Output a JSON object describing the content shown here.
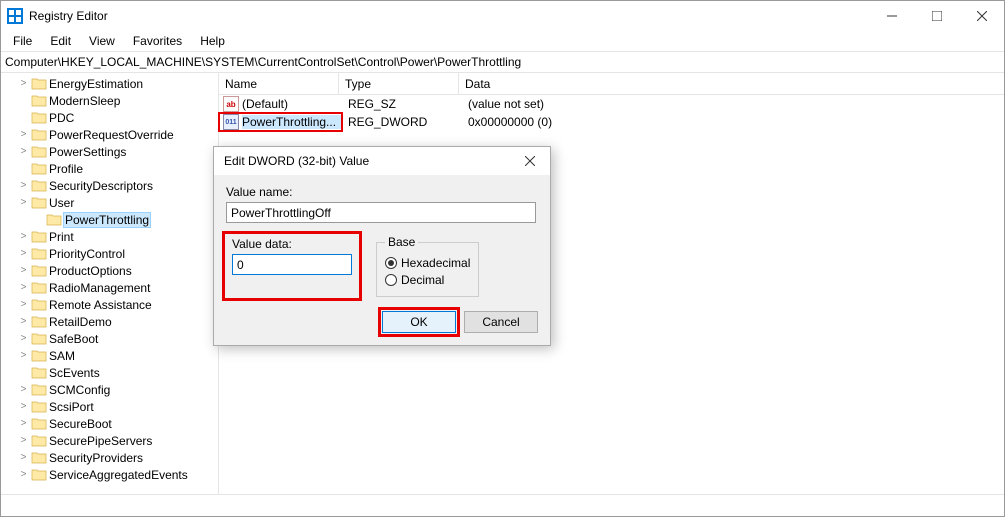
{
  "window": {
    "title": "Registry Editor"
  },
  "menu": {
    "file": "File",
    "edit": "Edit",
    "view": "View",
    "favorites": "Favorites",
    "help": "Help"
  },
  "address": "Computer\\HKEY_LOCAL_MACHINE\\SYSTEM\\CurrentControlSet\\Control\\Power\\PowerThrottling",
  "tree": {
    "items": [
      "EnergyEstimation",
      "ModernSleep",
      "PDC",
      "PowerRequestOverride",
      "PowerSettings",
      "Profile",
      "SecurityDescriptors",
      "User",
      "PowerThrottling",
      "Print",
      "PriorityControl",
      "ProductOptions",
      "RadioManagement",
      "Remote Assistance",
      "RetailDemo",
      "SafeBoot",
      "SAM",
      "ScEvents",
      "SCMConfig",
      "ScsiPort",
      "SecureBoot",
      "SecurePipeServers",
      "SecurityProviders",
      "ServiceAggregatedEvents"
    ],
    "selected_index": 8,
    "expandable": [
      0,
      3,
      4,
      6,
      7,
      9,
      10,
      11,
      12,
      13,
      14,
      15,
      16,
      18,
      19,
      20,
      21,
      22,
      23
    ]
  },
  "list": {
    "headers": {
      "name": "Name",
      "type": "Type",
      "data": "Data"
    },
    "rows": [
      {
        "icon": "str",
        "name": "(Default)",
        "type": "REG_SZ",
        "data": "(value not set)"
      },
      {
        "icon": "dw",
        "name": "PowerThrottling...",
        "type": "REG_DWORD",
        "data": "0x00000000 (0)"
      }
    ],
    "selected_index": 1
  },
  "dialog": {
    "title": "Edit DWORD (32-bit) Value",
    "value_name_label": "Value name:",
    "value_name": "PowerThrottlingOff",
    "value_data_label": "Value data:",
    "value_data": "0",
    "base_label": "Base",
    "hex_label": "Hexadecimal",
    "dec_label": "Decimal",
    "base": "hex",
    "ok": "OK",
    "cancel": "Cancel"
  }
}
